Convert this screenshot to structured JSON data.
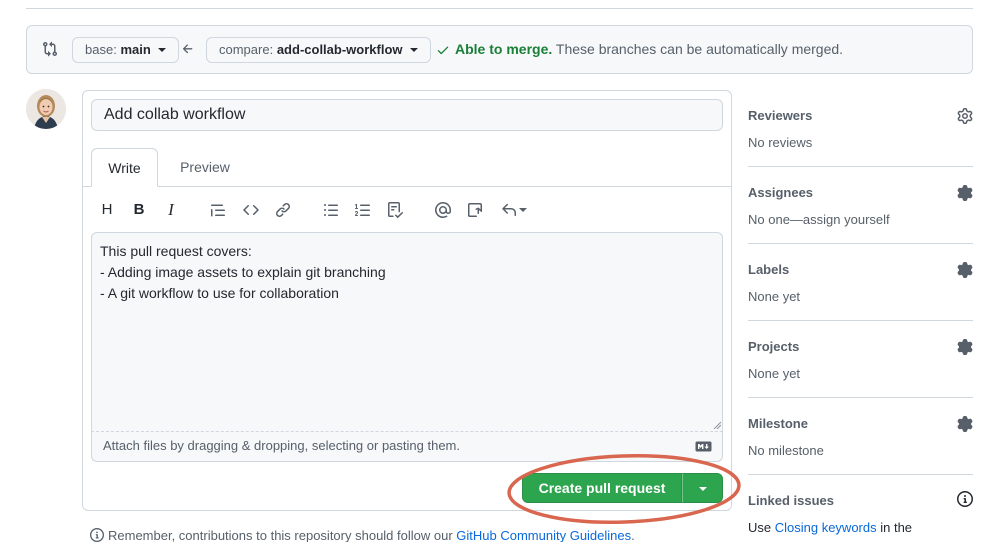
{
  "compare": {
    "base_prefix": "base:",
    "base_branch": "main",
    "compare_prefix": "compare:",
    "compare_branch": "add-collab-workflow",
    "merge_status": "Able to merge.",
    "merge_detail": "These branches can be automatically merged."
  },
  "pr": {
    "title": "Add collab workflow",
    "tabs": [
      "Write",
      "Preview"
    ],
    "body_lines": [
      "This pull request covers:",
      "- Adding image assets to explain git branching",
      "- A git workflow to use for collaboration"
    ],
    "attach_hint": "Attach files by dragging & dropping, selecting or pasting them.",
    "create_label": "Create pull request"
  },
  "toolbar": {
    "heading": "H",
    "bold": "B",
    "italic": "I"
  },
  "sidebar": {
    "reviewers": {
      "label": "Reviewers",
      "value": "No reviews"
    },
    "assignees": {
      "label": "Assignees",
      "value": "No one—assign yourself"
    },
    "labels": {
      "label": "Labels",
      "value": "None yet"
    },
    "projects": {
      "label": "Projects",
      "value": "None yet"
    },
    "milestone": {
      "label": "Milestone",
      "value": "No milestone"
    },
    "linked_issues": {
      "label": "Linked issues",
      "value_prefix": "Use ",
      "value_link": "Closing keywords",
      "value_suffix": " in the"
    }
  },
  "footer": {
    "prefix": "Remember, contributions to this repository should follow our ",
    "link": "GitHub Community Guidelines",
    "suffix": "."
  },
  "colors": {
    "accent": "#2da44e",
    "merge_ok": "#1a7f37",
    "link": "#0969da",
    "highlight": "#d9664f"
  },
  "icons": [
    "compare-icon",
    "arrow-left-icon",
    "check-icon",
    "heading-icon",
    "bold-icon",
    "italic-icon",
    "quote-icon",
    "code-icon",
    "link-icon",
    "unordered-list-icon",
    "ordered-list-icon",
    "task-list-icon",
    "mention-icon",
    "reference-icon",
    "undo-icon",
    "markdown-icon",
    "gear-icon",
    "info-icon"
  ]
}
